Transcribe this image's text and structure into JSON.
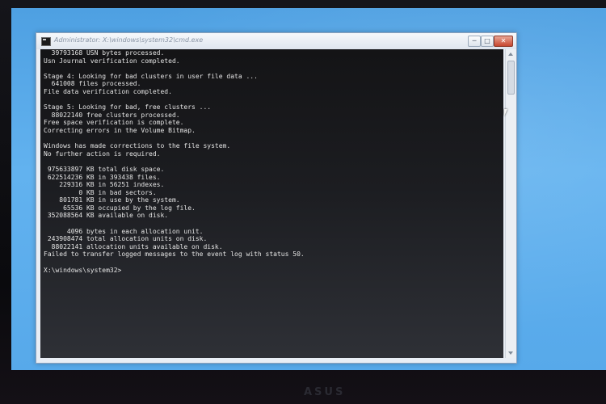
{
  "window": {
    "title": "Administrator: X:\\windows\\system32\\cmd.exe",
    "buttons": {
      "minimize": "─",
      "maximize": "□",
      "close": "✕"
    }
  },
  "console": {
    "lines": [
      "  39793168 USN bytes processed.",
      "Usn Journal verification completed.",
      "",
      "Stage 4: Looking for bad clusters in user file data ...",
      "  641008 files processed.",
      "File data verification completed.",
      "",
      "Stage 5: Looking for bad, free clusters ...",
      "  88022140 free clusters processed.",
      "Free space verification is complete.",
      "Correcting errors in the Volume Bitmap.",
      "",
      "Windows has made corrections to the file system.",
      "No further action is required.",
      "",
      " 975633897 KB total disk space.",
      " 622514236 KB in 393438 files.",
      "    229316 KB in 56251 indexes.",
      "         0 KB in bad sectors.",
      "    801781 KB in use by the system.",
      "     65536 KB occupied by the log file.",
      " 352088564 KB available on disk.",
      "",
      "      4096 bytes in each allocation unit.",
      " 243908474 total allocation units on disk.",
      "  88022141 allocation units available on disk.",
      "Failed to transfer logged messages to the event log with status 50.",
      "",
      "X:\\windows\\system32>"
    ]
  },
  "monitor": {
    "brand": "ASUS"
  }
}
